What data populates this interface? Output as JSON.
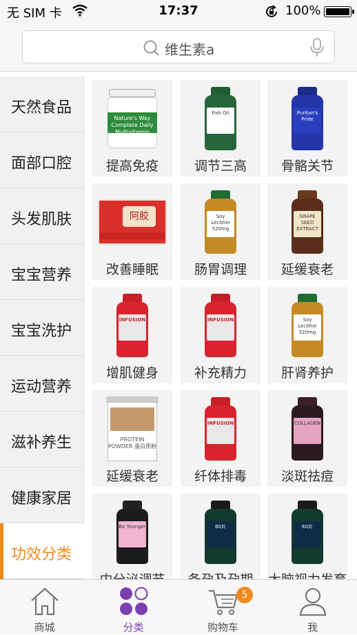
{
  "status_bar": {
    "carrier": "无 SIM 卡",
    "time": "17:37",
    "battery": "100%"
  },
  "search": {
    "placeholder": "维生素a"
  },
  "sidebar": {
    "items": [
      {
        "label": "天然食品"
      },
      {
        "label": "面部口腔"
      },
      {
        "label": "头发肌肤"
      },
      {
        "label": "宝宝营养"
      },
      {
        "label": "宝宝洗护"
      },
      {
        "label": "运动营养"
      },
      {
        "label": "滋补养生"
      },
      {
        "label": "健康家居"
      },
      {
        "label": "功效分类"
      }
    ],
    "active_index": 8
  },
  "grid": {
    "items": [
      {
        "label": "提高免疫",
        "icon": "multivitamin-jar-icon",
        "product_text": "Nature's Way Complete Daily Multivitamin"
      },
      {
        "label": "调节三高",
        "icon": "fish-oil-bottle-icon",
        "product_text": "Fish Oil"
      },
      {
        "label": "骨骼关节",
        "icon": "joint-supplement-bottle-icon",
        "product_text": "Puritan's Pride"
      },
      {
        "label": "改善睡眠",
        "icon": "ejiao-box-icon",
        "product_text": "阿胶"
      },
      {
        "label": "肠胃调理",
        "icon": "soy-lecithin-bottle-icon",
        "product_text": "Soy Lecithin 520mg"
      },
      {
        "label": "延缓衰老",
        "icon": "grape-seed-bottle-icon",
        "product_text": "GRAPE SEED EXTRACT"
      },
      {
        "label": "增肌健身",
        "icon": "red-supplement-bottle-icon",
        "product_text": "INFUSION"
      },
      {
        "label": "补充精力",
        "icon": "red-supplement-bottle-icon",
        "product_text": "INFUSION"
      },
      {
        "label": "肝肾养护",
        "icon": "soy-lecithin-bottle-icon",
        "product_text": "Soy Lecithin 520mg"
      },
      {
        "label": "延缓衰老",
        "icon": "protein-powder-can-icon",
        "product_text": "PROTEIN POWDER 蛋白质粉"
      },
      {
        "label": "纤体排毒",
        "icon": "red-supplement-bottle-icon",
        "product_text": "INFUSION"
      },
      {
        "label": "淡斑祛痘",
        "icon": "collagen-bottle-icon",
        "product_text": "COLLAGEN"
      },
      {
        "label": "内分泌调节",
        "icon": "pink-supplement-bottle-icon",
        "product_text": "Be Younger"
      },
      {
        "label": "备孕及孕期",
        "icon": "dark-supplement-bottle-icon",
        "product_text": "60片"
      },
      {
        "label": "大脑视力发育",
        "icon": "dark-supplement-bottle-icon",
        "product_text": "60片"
      }
    ]
  },
  "tabbar": {
    "items": [
      {
        "label": "商城",
        "icon": "home-icon"
      },
      {
        "label": "分类",
        "icon": "category-icon"
      },
      {
        "label": "购物车",
        "icon": "cart-icon"
      },
      {
        "label": "我",
        "icon": "profile-icon"
      }
    ],
    "cart_badge": "5",
    "active_index": 1
  },
  "colors": {
    "accent": "#f08a1c",
    "tab_active": "#7b3fb0"
  }
}
